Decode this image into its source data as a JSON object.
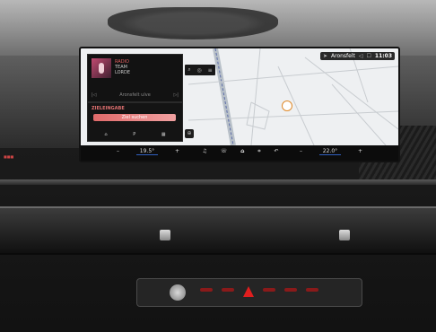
{
  "status": {
    "location": "Aronsfelt",
    "time": "11:03",
    "icons": [
      "navigation-arrow-icon",
      "volume-icon",
      "phone-icon"
    ]
  },
  "media": {
    "station": "RADIO",
    "title": "TEAM",
    "artist": "LORDE",
    "prev_label": "|◁",
    "location_label": "Aronsfelt ulve",
    "next_label": "▷|"
  },
  "destination": {
    "label": "ZIELEINGABE",
    "search_label": "Ziel suchen",
    "shortcuts": [
      "⌂",
      "P",
      "▦"
    ]
  },
  "map_tools": [
    "⌕",
    "◎",
    "≡"
  ],
  "compass_label": "⊕",
  "climate": {
    "left_minus": "–",
    "left_temp": "19.5°",
    "left_plus": "+",
    "center_icons": [
      "♫",
      "☏",
      "⌂",
      "⌗",
      "↶"
    ],
    "right_minus": "–",
    "right_temp": "22.0°",
    "right_plus": "+"
  },
  "left_indicator": "■■■",
  "colors": {
    "accent_red": "#e06a6a",
    "temp_blue": "#3060c0",
    "hazard_red": "#e01e1e"
  }
}
